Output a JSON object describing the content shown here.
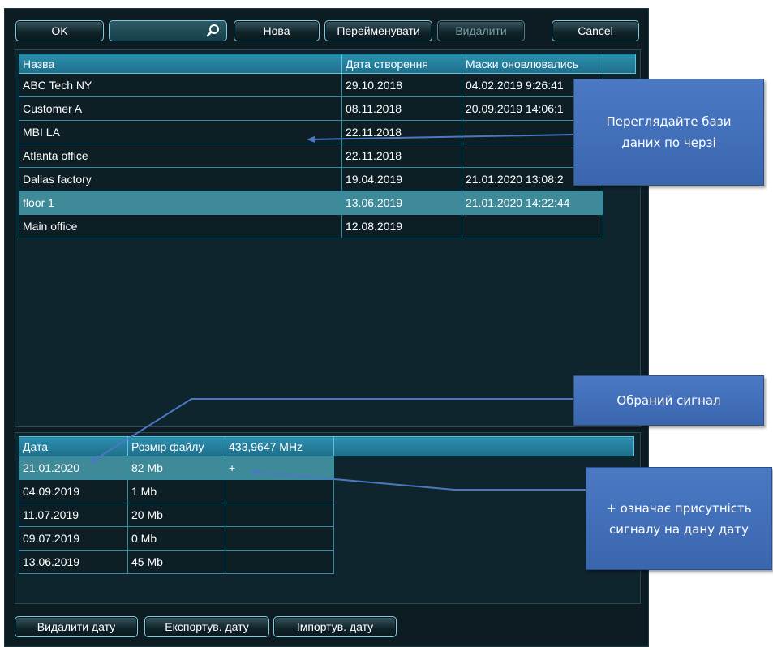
{
  "toolbar": {
    "ok_label": "OK",
    "new_label": "Нова",
    "rename_label": "Перейменувати",
    "delete_label": "Видалити",
    "cancel_label": "Cancel",
    "search_icon": "search-icon"
  },
  "databases": {
    "columns": [
      "Назва",
      "Дата створення",
      "Маски оновлювались",
      ""
    ],
    "rows": [
      {
        "name": "ABC Tech NY",
        "created": "29.10.2018",
        "masks": "04.02.2019 9:26:41"
      },
      {
        "name": "Customer A",
        "created": "08.11.2018",
        "masks": "20.09.2019 14:06:1"
      },
      {
        "name": "MBI LA",
        "created": "22.11.2018",
        "masks": ""
      },
      {
        "name": "Atlanta office",
        "created": "22.11.2018",
        "masks": ""
      },
      {
        "name": "Dallas factory",
        "created": "19.04.2019",
        "masks": "21.01.2020 13:08:2"
      },
      {
        "name": "floor 1",
        "created": "13.06.2019",
        "masks": "21.01.2020 14:22:44"
      },
      {
        "name": "Main office",
        "created": "12.08.2019",
        "masks": ""
      }
    ],
    "selected_index": 5
  },
  "signals": {
    "columns": [
      "Дата",
      "Розмір файлу",
      "433,9647 MHz",
      ""
    ],
    "rows": [
      {
        "date": "21.01.2020",
        "size": "82 Mb",
        "freq": "+"
      },
      {
        "date": "04.09.2019",
        "size": "1 Mb",
        "freq": ""
      },
      {
        "date": "11.07.2019",
        "size": "20 Mb",
        "freq": ""
      },
      {
        "date": "09.07.2019",
        "size": "0 Mb",
        "freq": ""
      },
      {
        "date": "13.06.2019",
        "size": "45 Mb",
        "freq": ""
      }
    ],
    "selected_index": 0
  },
  "bottom_bar": {
    "delete_date_label": "Видалити дату",
    "export_date_label": "Експортув. дату",
    "import_date_label": "Імпортув. дату"
  },
  "callouts": {
    "browse": "Переглядайте бази\nданих по черзі",
    "selected_signal": "Обраний сигнал",
    "plus_meaning": "+ означає присутність\nсигналу на дану дату"
  },
  "colors": {
    "window_bg": "#0c1c22",
    "header_bg": "#2b8fae",
    "selected_row": "#3f8a98",
    "callout_bg": "#4b79c4"
  }
}
